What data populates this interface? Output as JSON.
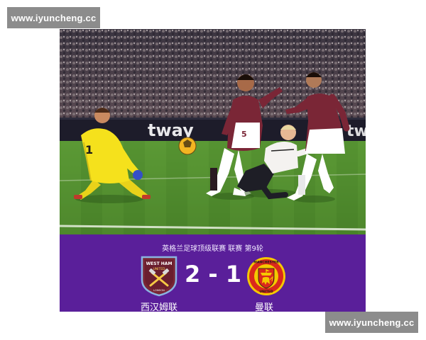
{
  "watermarks": {
    "top": "www.iyuncheng.cc",
    "bottom": "www.iyuncheng.cc"
  },
  "photo": {
    "ad_board_text": "tway",
    "ad_board_right_text": "tw",
    "goalkeeper_number": "1",
    "player_number": "5"
  },
  "match": {
    "competition": "英格兰足球顶级联赛 联赛 第9轮",
    "home_team": "西汉姆联",
    "away_team": "曼联",
    "score": "2 - 1",
    "home_crest": {
      "icon": "west-ham-crest-icon",
      "text_top": "WEST HAM",
      "text_mid": "UNITED",
      "text_bottom": "LONDON"
    },
    "away_crest": {
      "icon": "manchester-united-crest-icon",
      "text_top": "MANCHESTER",
      "text_bottom": "UNITED"
    }
  },
  "colors": {
    "banner": "#5a1f9a",
    "pitch": "#4f8a2c",
    "west_ham_claret": "#7a2636",
    "man_utd_red": "#da291c",
    "keeper_kit": "#f5e11c"
  }
}
